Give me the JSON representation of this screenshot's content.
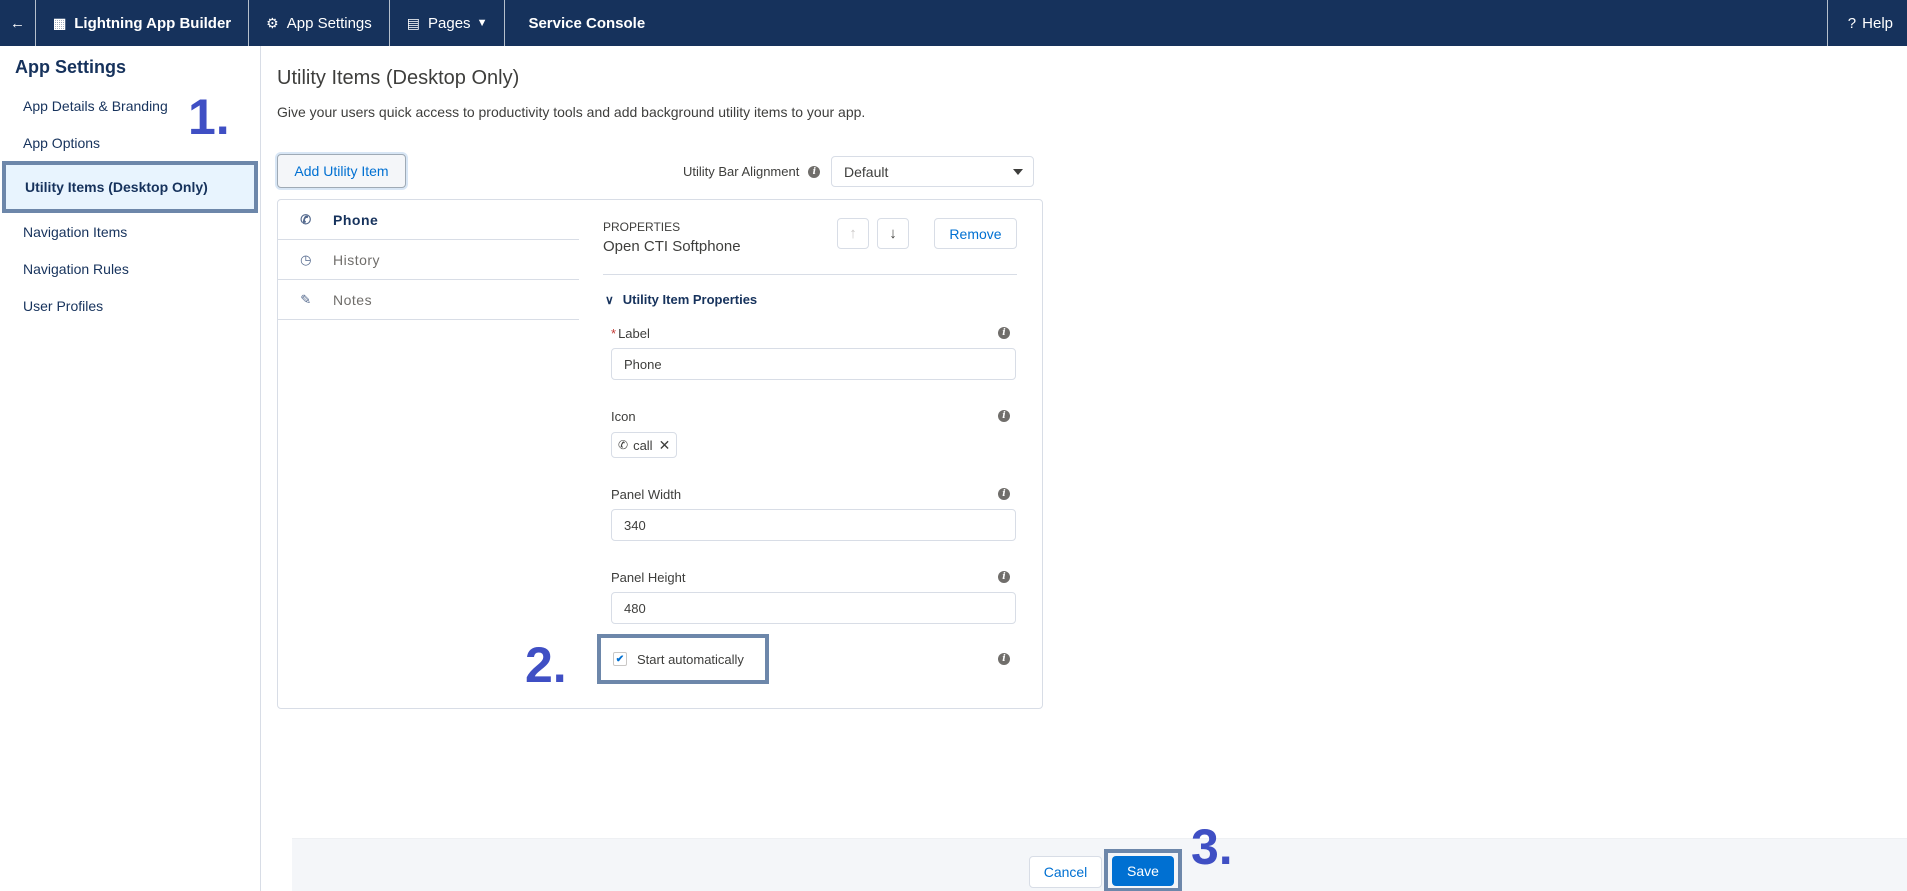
{
  "topbar": {
    "app_name": "Lightning App Builder",
    "app_settings": "App Settings",
    "pages": "Pages",
    "console_name": "Service Console",
    "help": "Help"
  },
  "sidebar": {
    "title": "App Settings",
    "items": [
      {
        "label": "App Details & Branding"
      },
      {
        "label": "App Options"
      },
      {
        "label": "Utility Items (Desktop Only)"
      },
      {
        "label": "Navigation Items"
      },
      {
        "label": "Navigation Rules"
      },
      {
        "label": "User Profiles"
      }
    ]
  },
  "main": {
    "title": "Utility Items (Desktop Only)",
    "description": "Give your users quick access to productivity tools and add background utility items to your app.",
    "add_button": "Add Utility Item",
    "alignment_label": "Utility Bar Alignment",
    "alignment_value": "Default"
  },
  "utility_list": [
    {
      "label": "Phone",
      "icon": "phone-icon"
    },
    {
      "label": "History",
      "icon": "clock-icon"
    },
    {
      "label": "Notes",
      "icon": "notes-icon"
    }
  ],
  "properties": {
    "kicker": "PROPERTIES",
    "component": "Open CTI Softphone",
    "remove": "Remove",
    "section": "Utility Item Properties",
    "label_field": {
      "label": "Label",
      "required_mark": "*",
      "value": "Phone"
    },
    "icon_field": {
      "label": "Icon",
      "value": "call"
    },
    "width_field": {
      "label": "Panel Width",
      "value": "340"
    },
    "height_field": {
      "label": "Panel Height",
      "value": "480"
    },
    "start_auto": {
      "label": "Start automatically",
      "checked": true
    }
  },
  "steps": {
    "one": "1.",
    "two": "2.",
    "three": "3."
  },
  "footer": {
    "cancel": "Cancel",
    "save": "Save"
  },
  "colors": {
    "topbar": "#16325c",
    "brand": "#0070d2",
    "annotation": "#3f4fc4"
  }
}
